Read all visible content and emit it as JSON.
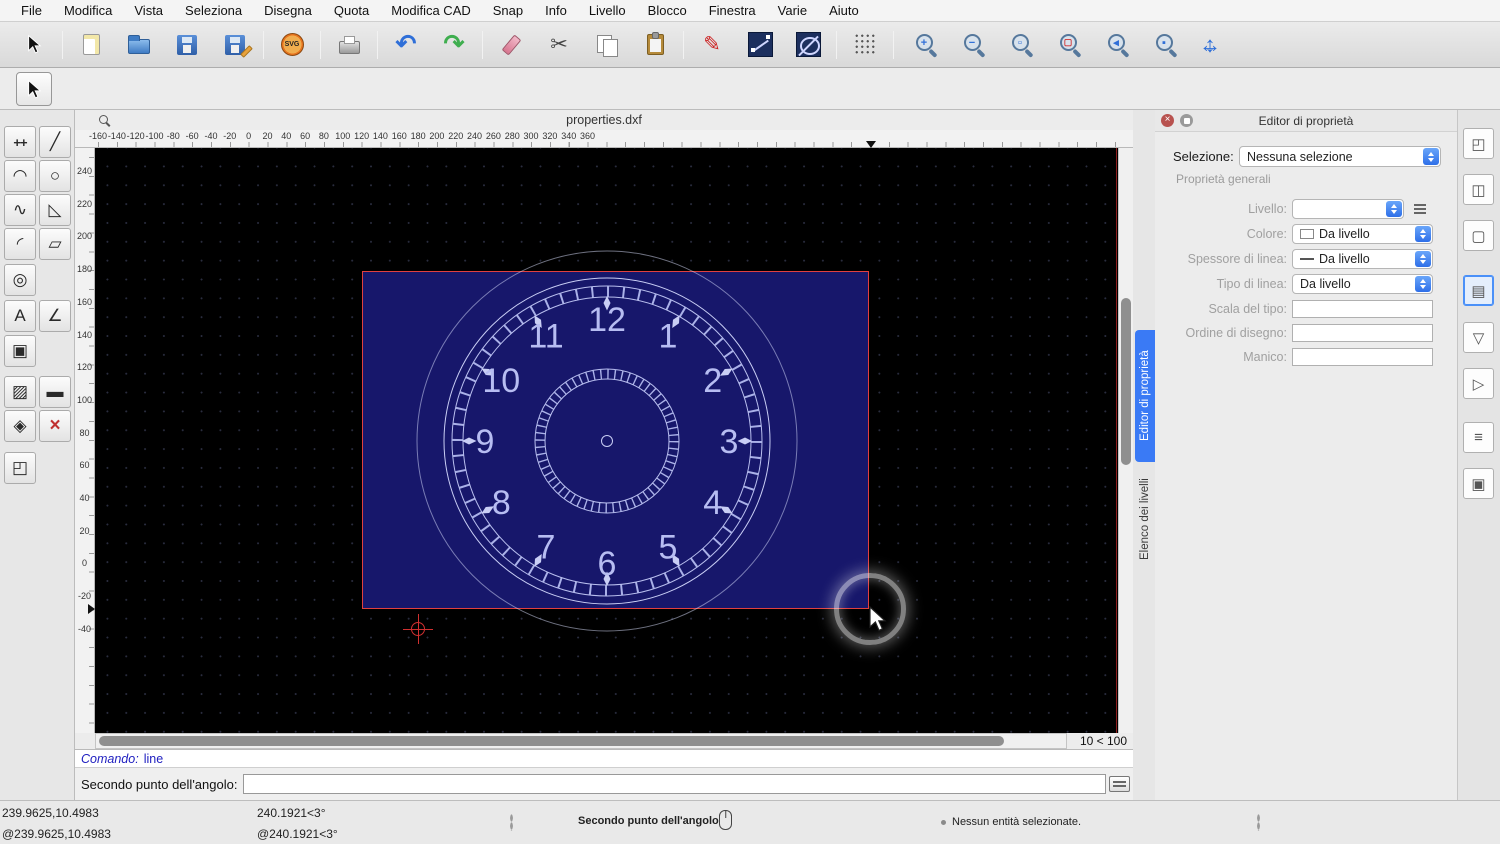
{
  "menubar": {
    "items": [
      "File",
      "Modifica",
      "Vista",
      "Seleziona",
      "Disegna",
      "Quota",
      "Modifica CAD",
      "Snap",
      "Info",
      "Livello",
      "Blocco",
      "Finestra",
      "Varie",
      "Aiuto"
    ]
  },
  "icons": {
    "undo": "↶",
    "redo": "↷",
    "cut": "✂",
    "pen": "✎",
    "svg": "SVG",
    "zoom_in": "+",
    "zoom_out": "−",
    "zoom_auto": "▫",
    "zoom_select": "▢",
    "zoom_prev": "◂",
    "zoom_window": "▪",
    "pan_h": "↔",
    "pan_v": "↕",
    "close": "×"
  },
  "palette": {
    "tools": [
      {
        "name": "point-tool",
        "glyph": "++"
      },
      {
        "name": "line-tool",
        "glyph": "╱"
      },
      {
        "name": "arc-tool",
        "glyph": "◠"
      },
      {
        "name": "circle-tool",
        "glyph": "○"
      },
      {
        "name": "spline-tool",
        "glyph": "∿"
      },
      {
        "name": "polyline-tool",
        "glyph": "◺"
      },
      {
        "name": "fillet-tool",
        "glyph": "◜"
      },
      {
        "name": "polygon-tool",
        "glyph": "▱"
      },
      {
        "name": "ellipse-tool",
        "glyph": "◎"
      },
      {
        "name": "text-tool",
        "glyph": "A"
      },
      {
        "name": "dimension-tool",
        "glyph": "∠"
      },
      {
        "name": "image-tool",
        "glyph": "▣"
      },
      {
        "name": "hatch-tool",
        "glyph": "▨"
      },
      {
        "name": "ruler-tool",
        "glyph": "▬"
      },
      {
        "name": "shape-tool",
        "glyph": "◈"
      },
      {
        "name": "measure-tool",
        "glyph": "×"
      },
      {
        "name": "box3d-tool",
        "glyph": "◰"
      }
    ]
  },
  "document": {
    "title": "properties.dxf"
  },
  "rulers": {
    "horizontal": [
      "-160",
      "-140",
      "-120",
      "-100",
      "-80",
      "-60",
      "-40",
      "-20",
      "0",
      "20",
      "40",
      "60",
      "80",
      "100",
      "120",
      "140",
      "160",
      "180",
      "200",
      "220",
      "240",
      "260",
      "280",
      "300",
      "320",
      "340",
      "360"
    ],
    "vertical": [
      "240",
      "220",
      "200",
      "180",
      "160",
      "140",
      "120",
      "100",
      "80",
      "60",
      "40",
      "20",
      "0",
      "-20",
      "-40"
    ]
  },
  "canvas": {
    "zoom_label": "10 < 100",
    "clock_numbers": [
      "12",
      "1",
      "2",
      "3",
      "4",
      "5",
      "6",
      "7",
      "8",
      "9",
      "10",
      "11"
    ]
  },
  "command": {
    "history_label": "Comando:",
    "history_value": "line",
    "prompt": "Secondo punto dell'angolo:",
    "value": ""
  },
  "statusbar": {
    "abs_xy": "239.9625,10.4983",
    "rel_xy": "@239.9625,10.4983",
    "abs_polar": "240.1921<3°",
    "rel_polar": "@240.1921<3°",
    "hint": "Secondo punto dell'angolo",
    "selection": "Nessun entità selezionate."
  },
  "panel": {
    "title": "Editor di proprietà",
    "selection_label": "Selezione:",
    "selection_value": "Nessuna selezione",
    "group": "Proprietà generali",
    "rows": [
      {
        "label": "Livello:",
        "value": ""
      },
      {
        "label": "Colore:",
        "value": "Da livello"
      },
      {
        "label": "Spessore di linea:",
        "value": "Da livello"
      },
      {
        "label": "Tipo di linea:",
        "value": "Da livello"
      },
      {
        "label": "Scala del tipo:",
        "value": ""
      },
      {
        "label": "Ordine di disegno:",
        "value": ""
      },
      {
        "label": "Manico:",
        "value": ""
      }
    ]
  },
  "tabs": {
    "property_editor": "Editor di proprietà",
    "layer_list": "Elenco dei livelli"
  },
  "right_icons": [
    {
      "name": "viewport-icon",
      "glyph": "◰"
    },
    {
      "name": "layers-icon",
      "glyph": "◫"
    },
    {
      "name": "blank-page-icon",
      "glyph": "▢"
    },
    {
      "name": "property-editor-icon",
      "glyph": "▤"
    },
    {
      "name": "filter-icon",
      "glyph": "▽"
    },
    {
      "name": "cam-icon",
      "glyph": "▷"
    },
    {
      "name": "command-list-icon",
      "glyph": "≡"
    },
    {
      "name": "clipboard-icon",
      "glyph": "▣"
    }
  ]
}
